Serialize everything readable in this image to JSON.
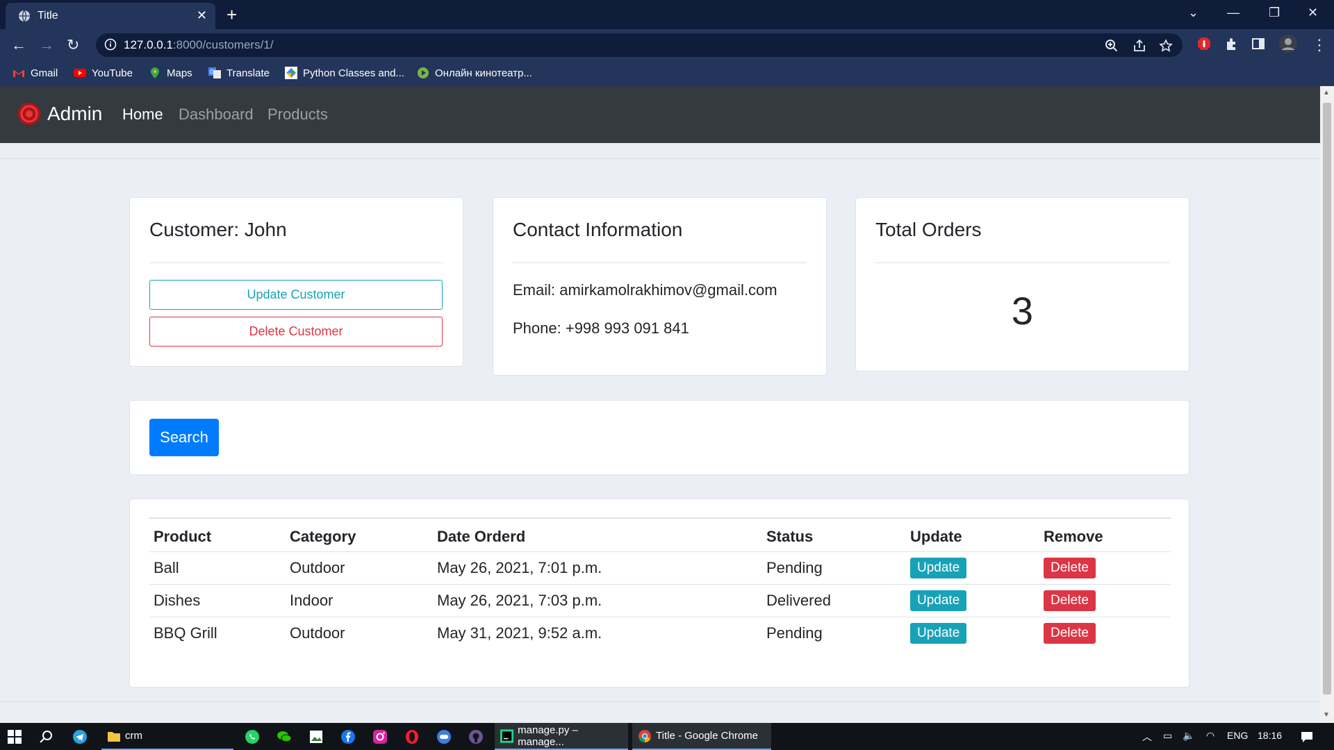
{
  "browser": {
    "tab_title": "Title",
    "url_host": "127.0.0.1",
    "url_rest": ":8000/customers/1/",
    "bookmarks": [
      {
        "label": "Gmail",
        "icon": "gmail-icon"
      },
      {
        "label": "YouTube",
        "icon": "youtube-icon"
      },
      {
        "label": "Maps",
        "icon": "maps-icon"
      },
      {
        "label": "Translate",
        "icon": "translate-icon"
      },
      {
        "label": "Python Classes and...",
        "icon": "python-icon"
      },
      {
        "label": "Онлайн кинотеатр...",
        "icon": "cinema-icon"
      }
    ]
  },
  "navbar": {
    "brand": "Admin",
    "links": [
      {
        "label": "Home",
        "active": true
      },
      {
        "label": "Dashboard",
        "active": false
      },
      {
        "label": "Products",
        "active": false
      }
    ]
  },
  "customer_card": {
    "title": "Customer: John",
    "update_label": "Update Customer",
    "delete_label": "Delete Customer"
  },
  "contact_card": {
    "title": "Contact Information",
    "email": "Email: amirkamolrakhimov@gmail.com",
    "phone": "Phone: +998 993 091 841"
  },
  "orders_card": {
    "title": "Total Orders",
    "count": "3"
  },
  "search": {
    "button_label": "Search"
  },
  "orders_table": {
    "headers": [
      "Product",
      "Category",
      "Date Orderd",
      "Status",
      "Update",
      "Remove"
    ],
    "rows": [
      {
        "product": "Ball",
        "category": "Outdoor",
        "date": "May 26, 2021, 7:01 p.m.",
        "status": "Pending",
        "update": "Update",
        "remove": "Delete"
      },
      {
        "product": "Dishes",
        "category": "Indoor",
        "date": "May 26, 2021, 7:03 p.m.",
        "status": "Delivered",
        "update": "Update",
        "remove": "Delete"
      },
      {
        "product": "BBQ Grill",
        "category": "Outdoor",
        "date": "May 31, 2021, 9:52 a.m.",
        "status": "Pending",
        "update": "Update",
        "remove": "Delete"
      }
    ]
  },
  "taskbar": {
    "folder_label": "crm",
    "pycharm_label": "manage.py – manage...",
    "chrome_label": "Title - Google Chrome",
    "language": "ENG",
    "time": "18:16"
  },
  "colors": {
    "primary": "#007bff",
    "info": "#17a2b8",
    "danger": "#dc3545",
    "navbar_bg": "#343a40",
    "page_bg": "#ebeef4"
  }
}
